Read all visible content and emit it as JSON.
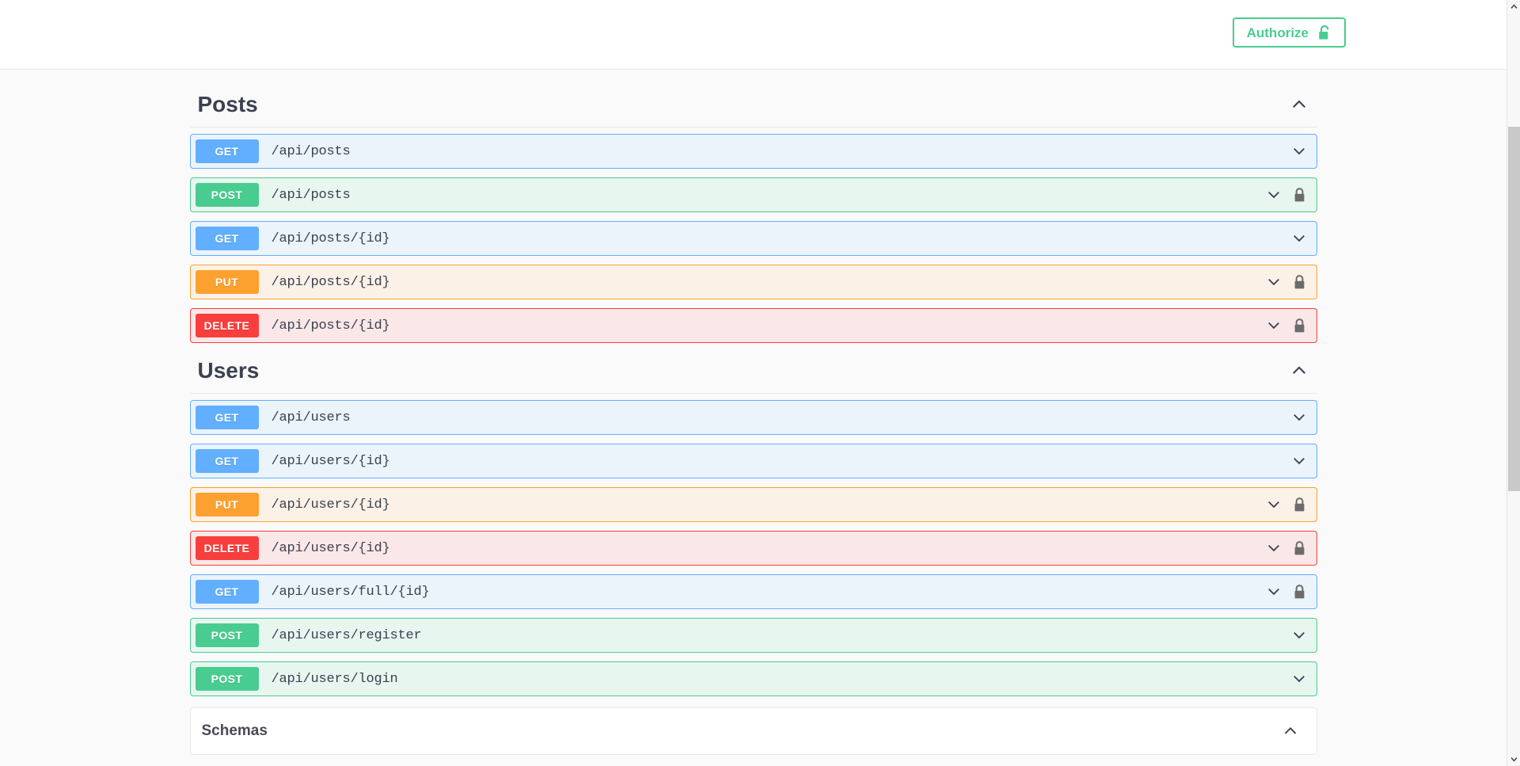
{
  "topbar": {
    "authorize_label": "Authorize",
    "authorize_icon": "unlock-icon"
  },
  "colors": {
    "get": "#61affe",
    "post": "#49cc90",
    "put": "#fca130",
    "delete": "#f93e3e",
    "get_bg": "#ebf3fb",
    "post_bg": "#e8f6f0",
    "put_bg": "#fbf1e6",
    "delete_bg": "#fae7e7",
    "authorize_accent": "#49cc90",
    "text": "#3b4151",
    "page_bg": "#fafafa"
  },
  "sections": [
    {
      "title": "Posts",
      "toggle_icon": "chevron-up-icon",
      "operations": [
        {
          "method": "GET",
          "path": "/api/posts",
          "secured": false,
          "chevron_icon": "chevron-down-icon"
        },
        {
          "method": "POST",
          "path": "/api/posts",
          "secured": true,
          "chevron_icon": "chevron-down-icon",
          "lock_icon": "lock-icon"
        },
        {
          "method": "GET",
          "path": "/api/posts/{id}",
          "secured": false,
          "chevron_icon": "chevron-down-icon"
        },
        {
          "method": "PUT",
          "path": "/api/posts/{id}",
          "secured": true,
          "chevron_icon": "chevron-down-icon",
          "lock_icon": "lock-icon"
        },
        {
          "method": "DELETE",
          "path": "/api/posts/{id}",
          "secured": true,
          "chevron_icon": "chevron-down-icon",
          "lock_icon": "lock-icon"
        }
      ]
    },
    {
      "title": "Users",
      "toggle_icon": "chevron-up-icon",
      "operations": [
        {
          "method": "GET",
          "path": "/api/users",
          "secured": false,
          "chevron_icon": "chevron-down-icon"
        },
        {
          "method": "GET",
          "path": "/api/users/{id}",
          "secured": false,
          "chevron_icon": "chevron-down-icon"
        },
        {
          "method": "PUT",
          "path": "/api/users/{id}",
          "secured": true,
          "chevron_icon": "chevron-down-icon",
          "lock_icon": "lock-icon"
        },
        {
          "method": "DELETE",
          "path": "/api/users/{id}",
          "secured": true,
          "chevron_icon": "chevron-down-icon",
          "lock_icon": "lock-icon"
        },
        {
          "method": "GET",
          "path": "/api/users/full/{id}",
          "secured": true,
          "chevron_icon": "chevron-down-icon",
          "lock_icon": "lock-icon"
        },
        {
          "method": "POST",
          "path": "/api/users/register",
          "secured": false,
          "chevron_icon": "chevron-down-icon"
        },
        {
          "method": "POST",
          "path": "/api/users/login",
          "secured": false,
          "chevron_icon": "chevron-down-icon"
        }
      ]
    }
  ],
  "schemas": {
    "title": "Schemas",
    "toggle_icon": "chevron-up-icon"
  },
  "scrollbar": {
    "up_icon": "scroll-up-arrow-icon",
    "down_icon": "scroll-down-arrow-icon"
  }
}
